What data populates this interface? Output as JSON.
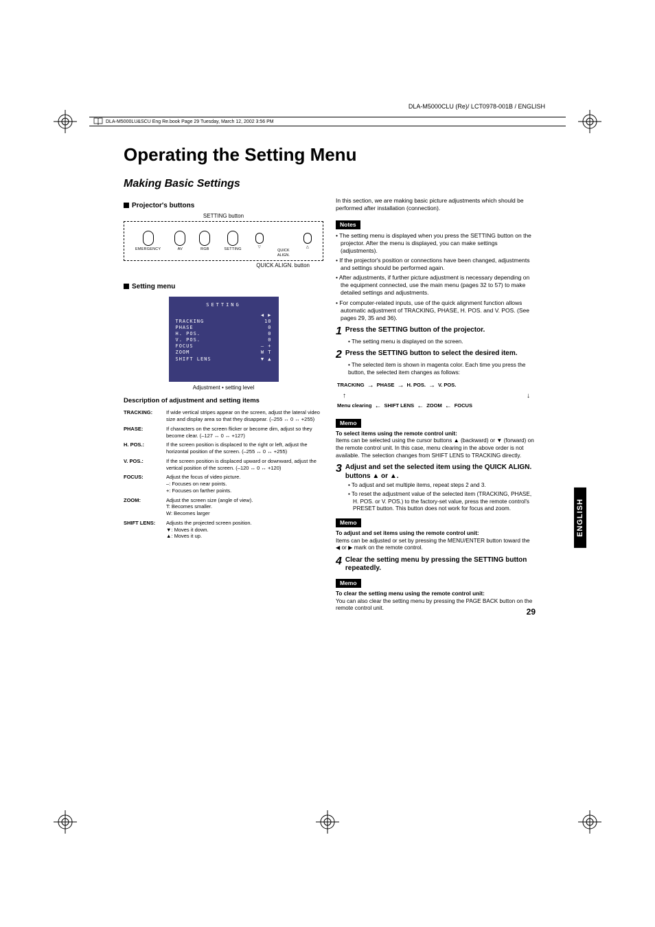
{
  "header": {
    "doc_id": "DLA-M5000CLU (Re)/ LCT0978-001B / ENGLISH",
    "book_line": "DLA-M5000LU&SCU Eng Re.book  Page 29  Tuesday, March 12, 2002  3:56 PM"
  },
  "title": "Operating the Setting Menu",
  "subtitle": "Making Basic Settings",
  "left": {
    "sec1_head": "Projector's buttons",
    "setting_btn_label": "SETTING button",
    "quick_align_label": "QUICK ALIGN. button",
    "buttons": {
      "b1": "EMERGENCY",
      "b2": "AV",
      "b3": "RGB",
      "b4": "SETTING",
      "b5a": "QUICK",
      "b5b": "ALIGN."
    },
    "sec2_head": "Setting menu",
    "menu": {
      "title": "SETTING",
      "r1l": "TRACKING",
      "r1v": "10",
      "r2l": "PHASE",
      "r2v": "0",
      "r3l": "H. POS.",
      "r3v": "0",
      "r4l": "V. POS.",
      "r4v": "0",
      "r5l": "FOCUS",
      "r5v": "–    +",
      "r6l": "ZOOM",
      "r6v": "W    T",
      "r7l": "SHIFT LENS",
      "r7v": "▼    ▲"
    },
    "caption": "Adjustment • setting level",
    "desc_head": "Description of adjustment and setting items",
    "desc": {
      "tracking_l": "TRACKING:",
      "tracking_v": "If wide vertical stripes appear on the screen, adjust the lateral video size and display area so that they disappear. (–255 ↔ 0 ↔ +255)",
      "phase_l": "PHASE:",
      "phase_v": "If characters on the screen flicker or become dim, adjust so they become clear. (–127 ↔ 0 ↔ +127)",
      "hpos_l": "H. POS.:",
      "hpos_v": "If the screen position is displaced to the right or left, adjust the horizontal position of the screen. (–255 ↔ 0 ↔ +255)",
      "vpos_l": "V. POS.:",
      "vpos_v": "If the screen position is displaced upward or downward, adjust the vertical position of the screen. (–120 ↔ 0 ↔ +120)",
      "focus_l": "FOCUS:",
      "focus_v1": "Adjust the focus of video picture.",
      "focus_v2": "–: Focuses on near points.",
      "focus_v3": "+: Focuses on farther points.",
      "zoom_l": "ZOOM:",
      "zoom_v1": "Adjust the screen size (angle of view).",
      "zoom_v2": "T:  Becomes smaller.",
      "zoom_v3": "W: Becomes larger",
      "shift_l": "SHIFT LENS:",
      "shift_v1": "Adjusts the projected screen position.",
      "shift_v2": "▼: Moves it down.",
      "shift_v3": "▲: Moves it up."
    }
  },
  "right": {
    "intro": "In this section, we are making basic picture adjustments which should be performed after installation (connection).",
    "notes_label": "Notes",
    "notes": {
      "n1": "The setting menu is displayed when you press the SETTING button on the projector. After the menu is displayed, you can make settings (adjustments).",
      "n2": "If the projector's position or connections have been changed, adjustments and settings should be performed again.",
      "n3": "After adjustments, if further picture adjustment is necessary depending on the equipment connected, use the main menu (pages 32 to 57) to make detailed settings and adjustments.",
      "n4": "For computer-related inputs, use of the quick alignment function allows automatic adjustment of TRACKING, PHASE, H. POS. and V. POS. (See pages 29, 35 and 36)."
    },
    "step1": "Press the SETTING button of the projector.",
    "step1_sub": "• The setting menu is displayed on the screen.",
    "step2": "Press the SETTING button to select the desired item.",
    "step2_sub": "• The selected item is shown in magenta color. Each time you press the button, the selected item changes as follows:",
    "flow": {
      "a": "TRACKING",
      "b": "PHASE",
      "c": "H. POS.",
      "d": "V. POS.",
      "e": "Menu clearing",
      "f": "SHIFT LENS",
      "g": "ZOOM",
      "h": "FOCUS"
    },
    "memo_label": "Memo",
    "memo1_title": "To select items using the remote control unit:",
    "memo1_body": "Items can be selected using the cursor buttons ▲ (backward) or ▼ (forward) on the remote control unit. In this case, menu clearing in the above order is not available. The selection changes from SHIFT LENS to TRACKING directly.",
    "step3a": "Adjust and set the selected item using ",
    "step3b": "the QUICK ALIGN. buttons ",
    "step3c": " or ",
    "step3d": ".",
    "step3_sub1": "To adjust and set multiple items, repeat steps 2 and 3.",
    "step3_sub2": "To reset the adjustment value of the selected item (TRACKING, PHASE, H. POS. or V. POS.) to the factory-set value, press the remote control's PRESET button. This button does not work for focus and zoom.",
    "memo2_title": "To adjust and set items using the remote control unit:",
    "memo2_body": "Items can be adjusted or set by pressing the MENU/ENTER button toward the ◀ or ▶ mark on the remote control.",
    "step4": "Clear the setting menu by pressing the SETTING button repeatedly.",
    "memo3_title": "To clear the setting menu using the remote control unit:",
    "memo3_body": "You can also clear the setting menu by pressing the PAGE BACK button on the remote control unit."
  },
  "side_tab": "ENGLISH",
  "page_number": "29"
}
